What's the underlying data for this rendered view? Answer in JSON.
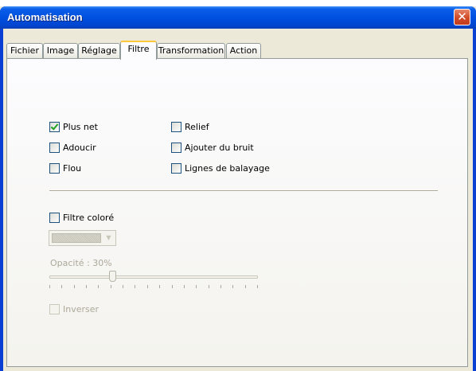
{
  "window": {
    "title": "Automatisation",
    "close_icon": "close-icon",
    "close_glyph": "✕",
    "colors": {
      "titlebar": "#0054e3",
      "close": "#d84a2a",
      "active_tab_accent": "#ffc83c"
    }
  },
  "tabs": [
    {
      "label": "Fichier",
      "active": false
    },
    {
      "label": "Image",
      "active": false
    },
    {
      "label": "Réglage",
      "active": false
    },
    {
      "label": "Filtre",
      "active": true
    },
    {
      "label": "Transformation",
      "active": false
    },
    {
      "label": "Action",
      "active": false
    }
  ],
  "filters": {
    "left": [
      {
        "label": "Plus net",
        "checked": true
      },
      {
        "label": "Adoucir",
        "checked": false
      },
      {
        "label": "Flou",
        "checked": false
      }
    ],
    "right": [
      {
        "label": "Relief",
        "checked": false
      },
      {
        "label": "Ajouter du bruit",
        "checked": false
      },
      {
        "label": "Lignes de balayage",
        "checked": false
      }
    ]
  },
  "color_filter": {
    "label": "Filtre coloré",
    "checked": false,
    "combo_arrow": "▼"
  },
  "opacity": {
    "label": "Opacité : 30%",
    "value": 0.3,
    "tick_count": 18
  },
  "invert": {
    "label": "Inverser",
    "checked": false,
    "disabled": true
  }
}
